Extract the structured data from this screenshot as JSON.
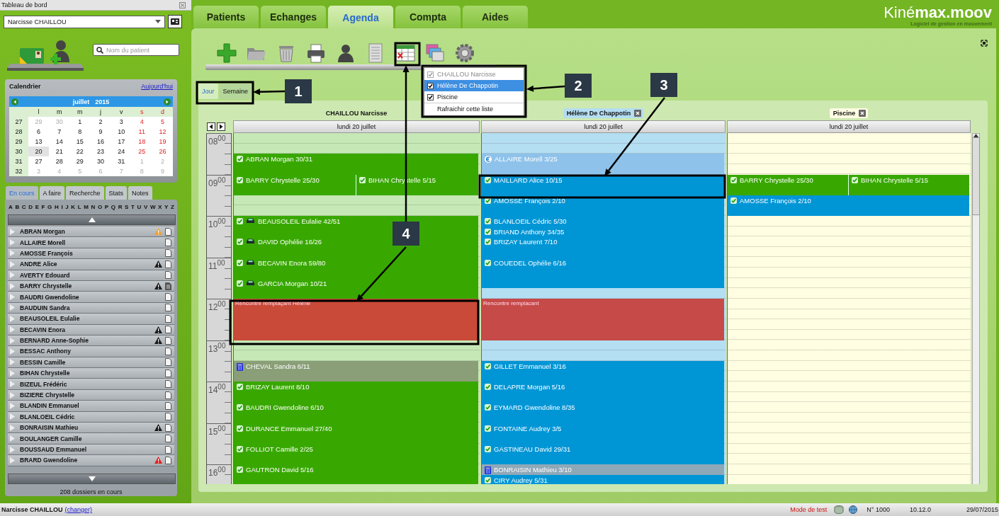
{
  "sidebar": {
    "title": "Tableau de bord",
    "practitioner": "Narcisse CHAILLOU",
    "search": {
      "placeholder": "Nom du patient"
    },
    "calendar": {
      "title": "Calendrier",
      "today_link": "Aujourd'hui",
      "month": "juillet",
      "year": "2015",
      "weekdays": [
        "l",
        "m",
        "m",
        "j",
        "v",
        "s",
        "d"
      ],
      "weeks": [
        {
          "num": "27",
          "days": [
            {
              "d": "29",
              "muted": true,
              "selected": false
            },
            {
              "d": "30",
              "muted": true,
              "selected": false
            },
            {
              "d": "1",
              "muted": false,
              "selected": false
            },
            {
              "d": "2",
              "muted": false,
              "selected": false
            },
            {
              "d": "3",
              "muted": false,
              "selected": false
            },
            {
              "d": "4",
              "muted": false,
              "selected": false
            },
            {
              "d": "5",
              "muted": false,
              "selected": false
            }
          ]
        },
        {
          "num": "28",
          "days": [
            {
              "d": "6",
              "muted": false,
              "selected": false
            },
            {
              "d": "7",
              "muted": false,
              "selected": false
            },
            {
              "d": "8",
              "muted": false,
              "selected": false
            },
            {
              "d": "9",
              "muted": false,
              "selected": false
            },
            {
              "d": "10",
              "muted": false,
              "selected": false
            },
            {
              "d": "11",
              "muted": false,
              "selected": false
            },
            {
              "d": "12",
              "muted": false,
              "selected": false
            }
          ]
        },
        {
          "num": "29",
          "days": [
            {
              "d": "13",
              "muted": false,
              "selected": false
            },
            {
              "d": "14",
              "muted": false,
              "selected": false
            },
            {
              "d": "15",
              "muted": false,
              "selected": false
            },
            {
              "d": "16",
              "muted": false,
              "selected": false
            },
            {
              "d": "17",
              "muted": false,
              "selected": false
            },
            {
              "d": "18",
              "muted": false,
              "selected": false
            },
            {
              "d": "19",
              "muted": false,
              "selected": false
            }
          ]
        },
        {
          "num": "30",
          "days": [
            {
              "d": "20",
              "muted": false,
              "selected": true
            },
            {
              "d": "21",
              "muted": false,
              "selected": false
            },
            {
              "d": "22",
              "muted": false,
              "selected": false
            },
            {
              "d": "23",
              "muted": false,
              "selected": false
            },
            {
              "d": "24",
              "muted": false,
              "selected": false
            },
            {
              "d": "25",
              "muted": false,
              "selected": false
            },
            {
              "d": "26",
              "muted": false,
              "selected": false
            }
          ]
        },
        {
          "num": "31",
          "days": [
            {
              "d": "27",
              "muted": false,
              "selected": false
            },
            {
              "d": "28",
              "muted": false,
              "selected": false
            },
            {
              "d": "29",
              "muted": false,
              "selected": false
            },
            {
              "d": "30",
              "muted": false,
              "selected": false
            },
            {
              "d": "31",
              "muted": false,
              "selected": false
            },
            {
              "d": "1",
              "muted": true,
              "selected": false
            },
            {
              "d": "2",
              "muted": true,
              "selected": false
            }
          ]
        },
        {
          "num": "32",
          "days": [
            {
              "d": "3",
              "muted": true,
              "selected": false
            },
            {
              "d": "4",
              "muted": true,
              "selected": false
            },
            {
              "d": "5",
              "muted": true,
              "selected": false
            },
            {
              "d": "6",
              "muted": true,
              "selected": false
            },
            {
              "d": "7",
              "muted": true,
              "selected": false
            },
            {
              "d": "8",
              "muted": true,
              "selected": false
            },
            {
              "d": "9",
              "muted": true,
              "selected": false
            }
          ]
        }
      ]
    },
    "tabs": [
      {
        "label": "En cours",
        "selected": true
      },
      {
        "label": "A faire",
        "selected": false
      },
      {
        "label": "Recherche",
        "selected": false
      },
      {
        "label": "Stats",
        "selected": false
      },
      {
        "label": "Notes",
        "selected": false
      }
    ],
    "alphabet": [
      "A",
      "B",
      "C",
      "D",
      "E",
      "F",
      "G",
      "H",
      "I",
      "J",
      "K",
      "L",
      "M",
      "N",
      "O",
      "P",
      "Q",
      "R",
      "S",
      "T",
      "U",
      "V",
      "W",
      "X",
      "Y",
      "Z"
    ],
    "patients": [
      {
        "name": "ABRAN Morgan",
        "alert": true,
        "color": "#f0a030",
        "doc_filled": false
      },
      {
        "name": "ALLAIRE Morell",
        "alert": false,
        "doc_filled": false
      },
      {
        "name": "AMOSSE François",
        "alert": false,
        "doc_filled": false
      },
      {
        "name": "ANDRE Alice",
        "alert": true,
        "color": "#1a1a1a",
        "doc_filled": false
      },
      {
        "name": "AVERTY Edouard",
        "alert": false,
        "doc_filled": false
      },
      {
        "name": "BARRY Chrystelle",
        "alert": true,
        "color": "#1a1a1a",
        "doc_filled": true
      },
      {
        "name": "BAUDRI Gwendoline",
        "alert": false,
        "doc_filled": false
      },
      {
        "name": "BAUDUIN Sandra",
        "alert": false,
        "doc_filled": false
      },
      {
        "name": "BEAUSOLEIL Eulalie",
        "alert": false,
        "doc_filled": false
      },
      {
        "name": "BECAVIN Enora",
        "alert": true,
        "color": "#1a1a1a",
        "doc_filled": false
      },
      {
        "name": "BERNARD Anne-Sophie",
        "alert": true,
        "color": "#1a1a1a",
        "doc_filled": false
      },
      {
        "name": "BESSAC Anthony",
        "alert": false,
        "doc_filled": false
      },
      {
        "name": "BESSIN Camille",
        "alert": false,
        "doc_filled": false
      },
      {
        "name": "BIHAN Chrystelle",
        "alert": false,
        "doc_filled": false
      },
      {
        "name": "BIZEUL Frédéric",
        "alert": false,
        "doc_filled": false
      },
      {
        "name": "BIZIERE Chrystelle",
        "alert": false,
        "doc_filled": false
      },
      {
        "name": "BLANDIN Emmanuel",
        "alert": false,
        "doc_filled": false
      },
      {
        "name": "BLANLOEIL Cédric",
        "alert": false,
        "doc_filled": false
      },
      {
        "name": "BONRAISIN Mathieu",
        "alert": true,
        "color": "#1a1a1a",
        "doc_filled": false
      },
      {
        "name": "BOULANGER Camille",
        "alert": false,
        "doc_filled": false
      },
      {
        "name": "BOUSSAUD Emmanuel",
        "alert": false,
        "doc_filled": false
      },
      {
        "name": "BRARD Gwendoline",
        "alert": true,
        "color": "#e02020",
        "doc_filled": false
      }
    ],
    "count": "208 dossiers en cours"
  },
  "main_tabs": [
    {
      "label": "Patients",
      "selected": false
    },
    {
      "label": "Echanges",
      "selected": false
    },
    {
      "label": "Agenda",
      "selected": true
    },
    {
      "label": "Compta",
      "selected": false
    },
    {
      "label": "Aides",
      "selected": false
    }
  ],
  "logo": {
    "name": "Kiné**max.moov**",
    "tagline": "Logiciel de gestion en mouvement"
  },
  "view_switch": [
    {
      "label": "Jour",
      "selected": true
    },
    {
      "label": "Semaine",
      "selected": false
    }
  ],
  "resource_menu": [
    {
      "kind": "check",
      "label": "CHAILLOU Narcisse",
      "checked": true,
      "disabled": true,
      "selected": false
    },
    {
      "kind": "check",
      "label": "Hélène De Chappotin",
      "checked": true,
      "disabled": false,
      "selected": true
    },
    {
      "kind": "check",
      "label": "Piscine",
      "checked": true,
      "disabled": false,
      "selected": false
    },
    {
      "kind": "action",
      "label": "Rafraichir cette liste",
      "disabled": false,
      "selected": false
    }
  ],
  "agenda": {
    "hours": [
      "08$^{00}$",
      "09$^{00}$",
      "10$^{00}$",
      "11$^{00}$",
      "12$^{00}$",
      "13$^{00}$",
      "14$^{00}$",
      "15$^{00}$",
      "16$^{00}$"
    ],
    "columns": [
      {
        "name": "CHAILLOU Narcisse",
        "closable": false,
        "color": "#c6e8b6",
        "date": "lundi 20 juillet",
        "events": [
          {
            "kind": "appointment",
            "color": "#38a800",
            "parts": [
              {
                "label": "ABRAN Morgan 30/31",
                "kind": "confirmed"
              }
            ]
          },
          {
            "kind": "appointment",
            "color": "#38a800",
            "parts": [
              {
                "label": "BARRY Chrystelle 25/30",
                "kind": "confirmed"
              },
              {
                "label": "BIHAN Chrystelle 5/15",
                "kind": "confirmed"
              }
            ]
          },
          {
            "kind": "appointment",
            "color": "#38a800",
            "parts": [
              {
                "label": "BEAUSOLEIL Eulalie 42/51",
                "kind": "transport"
              }
            ]
          },
          {
            "kind": "appointment",
            "color": "#38a800",
            "parts": [
              {
                "label": "DAVID Ophélie 16/26",
                "kind": "transport"
              }
            ]
          },
          {
            "kind": "appointment",
            "color": "#38a800",
            "parts": [
              {
                "label": "BECAVIN Enora 59/80",
                "kind": "transport"
              }
            ]
          },
          {
            "kind": "appointment",
            "color": "#38a800",
            "parts": [
              {
                "label": "GARCIA Morgan 10/21",
                "kind": "transport"
              }
            ]
          },
          {
            "kind": "note",
            "color": "#c94a38",
            "parts": [
              {
                "label": "Rencontre remplaçant Hélène"
              }
            ]
          },
          {
            "kind": "appointment",
            "color": "#8a9f78",
            "parts": [
              {
                "label": "CHEVAL Sandra 6/11",
                "kind": "billing"
              }
            ]
          },
          {
            "kind": "appointment",
            "color": "#38a800",
            "parts": [
              {
                "label": "BRIZAY Laurent 8/10",
                "kind": "confirmed"
              }
            ]
          },
          {
            "kind": "appointment",
            "color": "#38a800",
            "parts": [
              {
                "label": "BAUDRI Gwendoline 6/10",
                "kind": "confirmed"
              }
            ]
          },
          {
            "kind": "appointment",
            "color": "#38a800",
            "parts": [
              {
                "label": "DURANCE Emmanuel 27/40",
                "kind": "confirmed"
              }
            ]
          },
          {
            "kind": "appointment",
            "color": "#38a800",
            "parts": [
              {
                "label": "FOLLIOT Camille 2/25",
                "kind": "confirmed"
              }
            ]
          },
          {
            "kind": "appointment",
            "color": "#38a800",
            "parts": [
              {
                "label": "GAUTRON David 5/16",
                "kind": "confirmed"
              }
            ]
          }
        ]
      },
      {
        "name": "Hélène De Chappotin",
        "closable": true,
        "color": "#b4def2",
        "date": "lundi 20 juillet",
        "events": [
          {
            "kind": "appointment",
            "color": "#8ec2ea",
            "parts": [
              {
                "label": "ALLAIRE Morell 3/25",
                "kind": "payment"
              }
            ]
          },
          {
            "kind": "appointment",
            "color": "#0096d6",
            "parts": [
              {
                "label": "MAILLARD Alice 10/15",
                "kind": "confirmed"
              }
            ]
          },
          {
            "kind": "appointment",
            "color": "#0096d6",
            "parts": [
              {
                "label": "AMOSSE François 2/10",
                "kind": "confirmed"
              }
            ]
          },
          {
            "kind": "appointment",
            "color": "#0096d6",
            "parts": [
              {
                "label": "BLANLOEIL Cédric 5/30",
                "kind": "confirmed"
              }
            ]
          },
          {
            "kind": "appointment",
            "color": "#0096d6",
            "parts": [
              {
                "label": "BRIAND Anthony 34/35",
                "kind": "confirmed"
              }
            ]
          },
          {
            "kind": "appointment",
            "color": "#0096d6",
            "parts": [
              {
                "label": "BRIZAY Laurent 7/10",
                "kind": "confirmed"
              }
            ]
          },
          {
            "kind": "appointment",
            "color": "#0096d6",
            "parts": [
              {
                "label": "COUEDEL Ophélie 6/16",
                "kind": "confirmed"
              }
            ]
          },
          {
            "kind": "note",
            "color": "#c64a48",
            "parts": [
              {
                "label": "Rencontre remplacant"
              }
            ]
          },
          {
            "kind": "appointment",
            "color": "#0096d6",
            "parts": [
              {
                "label": "GILLET Emmanuel 3/16",
                "kind": "confirmed"
              }
            ]
          },
          {
            "kind": "appointment",
            "color": "#0096d6",
            "parts": [
              {
                "label": "DELAPRE Morgan 5/16",
                "kind": "confirmed"
              }
            ]
          },
          {
            "kind": "appointment",
            "color": "#0096d6",
            "parts": [
              {
                "label": "EYMARD Gwendoline 8/35",
                "kind": "confirmed"
              }
            ]
          },
          {
            "kind": "appointment",
            "color": "#0096d6",
            "parts": [
              {
                "label": "FONTAINE Audrey 3/5",
                "kind": "confirmed"
              }
            ]
          },
          {
            "kind": "appointment",
            "color": "#0096d6",
            "parts": [
              {
                "label": "GASTINEAU David 29/31",
                "kind": "confirmed"
              }
            ]
          },
          {
            "kind": "appointment",
            "color": "#8fa8b8",
            "parts": [
              {
                "label": "BONRAISIN Mathieu 3/10",
                "kind": "billing"
              }
            ]
          },
          {
            "kind": "appointment",
            "color": "#0096d6",
            "parts": [
              {
                "label": "CIRY Audrey 5/31",
                "kind": "confirmed"
              }
            ]
          }
        ]
      },
      {
        "name": "Piscine",
        "closable": true,
        "color": "#fffde2",
        "date": "lundi 20 juillet",
        "events": [
          {
            "kind": "appointment",
            "color": "#38a800",
            "parts": [
              {
                "label": "BARRY Chrystelle 25/30",
                "kind": "confirmed"
              },
              {
                "label": "BIHAN Chrystelle 5/15",
                "kind": "confirmed"
              }
            ]
          },
          {
            "kind": "appointment",
            "color": "#0096d6",
            "parts": [
              {
                "label": "AMOSSE François 2/10",
                "kind": "confirmed"
              }
            ]
          }
        ]
      }
    ]
  },
  "callouts": [
    {
      "label": "1"
    },
    {
      "label": "2"
    },
    {
      "label": "3"
    },
    {
      "label": "4"
    }
  ],
  "status_bar": {
    "user": "Narcisse CHAILLOU",
    "change_link": "(changer)",
    "mode": "Mode de test",
    "number": "N° 1000",
    "version": "10.12.0",
    "date": "29/07/2015"
  }
}
